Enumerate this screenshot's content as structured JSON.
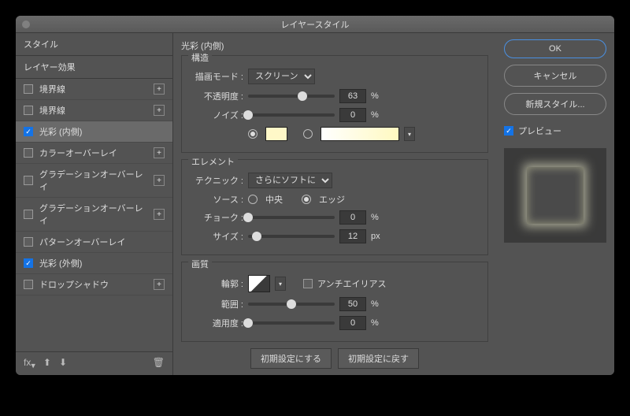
{
  "title": "レイヤースタイル",
  "left": {
    "header": "スタイル",
    "subheader": "レイヤー効果",
    "items": [
      {
        "label": "境界線",
        "checked": false,
        "plus": true,
        "selected": false
      },
      {
        "label": "境界線",
        "checked": false,
        "plus": true,
        "selected": false
      },
      {
        "label": "光彩 (内側)",
        "checked": true,
        "plus": false,
        "selected": true
      },
      {
        "label": "カラーオーバーレイ",
        "checked": false,
        "plus": true,
        "selected": false
      },
      {
        "label": "グラデーションオーバーレイ",
        "checked": false,
        "plus": true,
        "selected": false
      },
      {
        "label": "グラデーションオーバーレイ",
        "checked": false,
        "plus": true,
        "selected": false
      },
      {
        "label": "パターンオーバーレイ",
        "checked": false,
        "plus": false,
        "selected": false
      },
      {
        "label": "光彩 (外側)",
        "checked": true,
        "plus": false,
        "selected": false
      },
      {
        "label": "ドロップシャドウ",
        "checked": false,
        "plus": true,
        "selected": false
      }
    ]
  },
  "center": {
    "panel_title": "光彩 (内側)",
    "group1": {
      "title": "構造",
      "mode_label": "描画モード :",
      "mode_value": "スクリーン",
      "opacity_label": "不透明度 :",
      "opacity_value": "63",
      "opacity_unit": "%",
      "noise_label": "ノイズ :",
      "noise_value": "0",
      "noise_unit": "%"
    },
    "group2": {
      "title": "エレメント",
      "technique_label": "テクニック :",
      "technique_value": "さらにソフトに",
      "source_label": "ソース :",
      "source_center": "中央",
      "source_edge": "エッジ",
      "choke_label": "チョーク :",
      "choke_value": "0",
      "choke_unit": "%",
      "size_label": "サイズ :",
      "size_value": "12",
      "size_unit": "px"
    },
    "group3": {
      "title": "画質",
      "contour_label": "輪郭 :",
      "antialias_label": "アンチエイリアス",
      "range_label": "範囲 :",
      "range_value": "50",
      "range_unit": "%",
      "jitter_label": "適用度 :",
      "jitter_value": "0",
      "jitter_unit": "%"
    },
    "btn_default": "初期設定にする",
    "btn_reset": "初期設定に戻す"
  },
  "right": {
    "ok": "OK",
    "cancel": "キャンセル",
    "newstyle": "新規スタイル...",
    "preview": "プレビュー"
  }
}
